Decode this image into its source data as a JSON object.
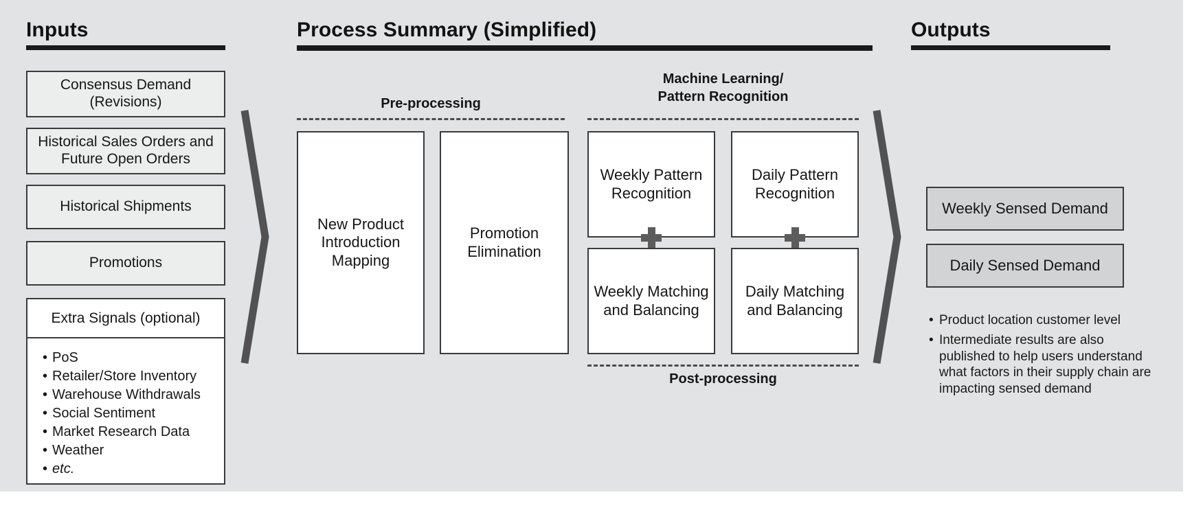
{
  "columns": {
    "inputs": {
      "title": "Inputs",
      "boxes": [
        "Consensus Demand (Revisions)",
        "Historical Sales Orders and Future Open Orders",
        "Historical Shipments",
        "Promotions"
      ],
      "extra": {
        "title": "Extra Signals (optional)",
        "items": [
          "PoS",
          "Retailer/Store Inventory",
          "Warehouse Withdrawals",
          "Social Sentiment",
          "Market Research Data",
          "Weather",
          "etc."
        ],
        "bullet": "•"
      }
    },
    "process": {
      "title": "Process Summary (Simplified)",
      "sections": {
        "preprocessing": "Pre-processing",
        "ml_line1": "Machine Learning/",
        "ml_line2": "Pattern Recognition",
        "postprocessing": "Post-processing"
      },
      "boxes": {
        "npi": "New Product Introduction Mapping",
        "promo_elim": "Promotion Elimination",
        "weekly_pattern": "Weekly Pattern Recognition",
        "daily_pattern": "Daily Pattern Recognition",
        "weekly_match": "Weekly Matching and Balancing",
        "daily_match": "Daily Matching and Balancing"
      },
      "operator": "+"
    },
    "outputs": {
      "title": "Outputs",
      "boxes": [
        "Weekly Sensed Demand",
        "Daily Sensed Demand"
      ],
      "notes": [
        "Product location customer level",
        "Intermediate results are also published to help users understand what factors in their supply chain are impacting sensed demand"
      ],
      "bullet": "•"
    }
  },
  "connectors": {
    "left_chevron": "chevron-right",
    "right_chevron": "chevron-right"
  },
  "colors": {
    "background": "#e2e3e4",
    "box_border": "#3a3a3a",
    "input_fill": "#eceded",
    "process_fill": "#ffffff",
    "output_fill": "#d2d3d4",
    "rule": "#1a1a1a",
    "chevron": "#525252",
    "plus": "#5c5c5c",
    "text": "#161616"
  }
}
